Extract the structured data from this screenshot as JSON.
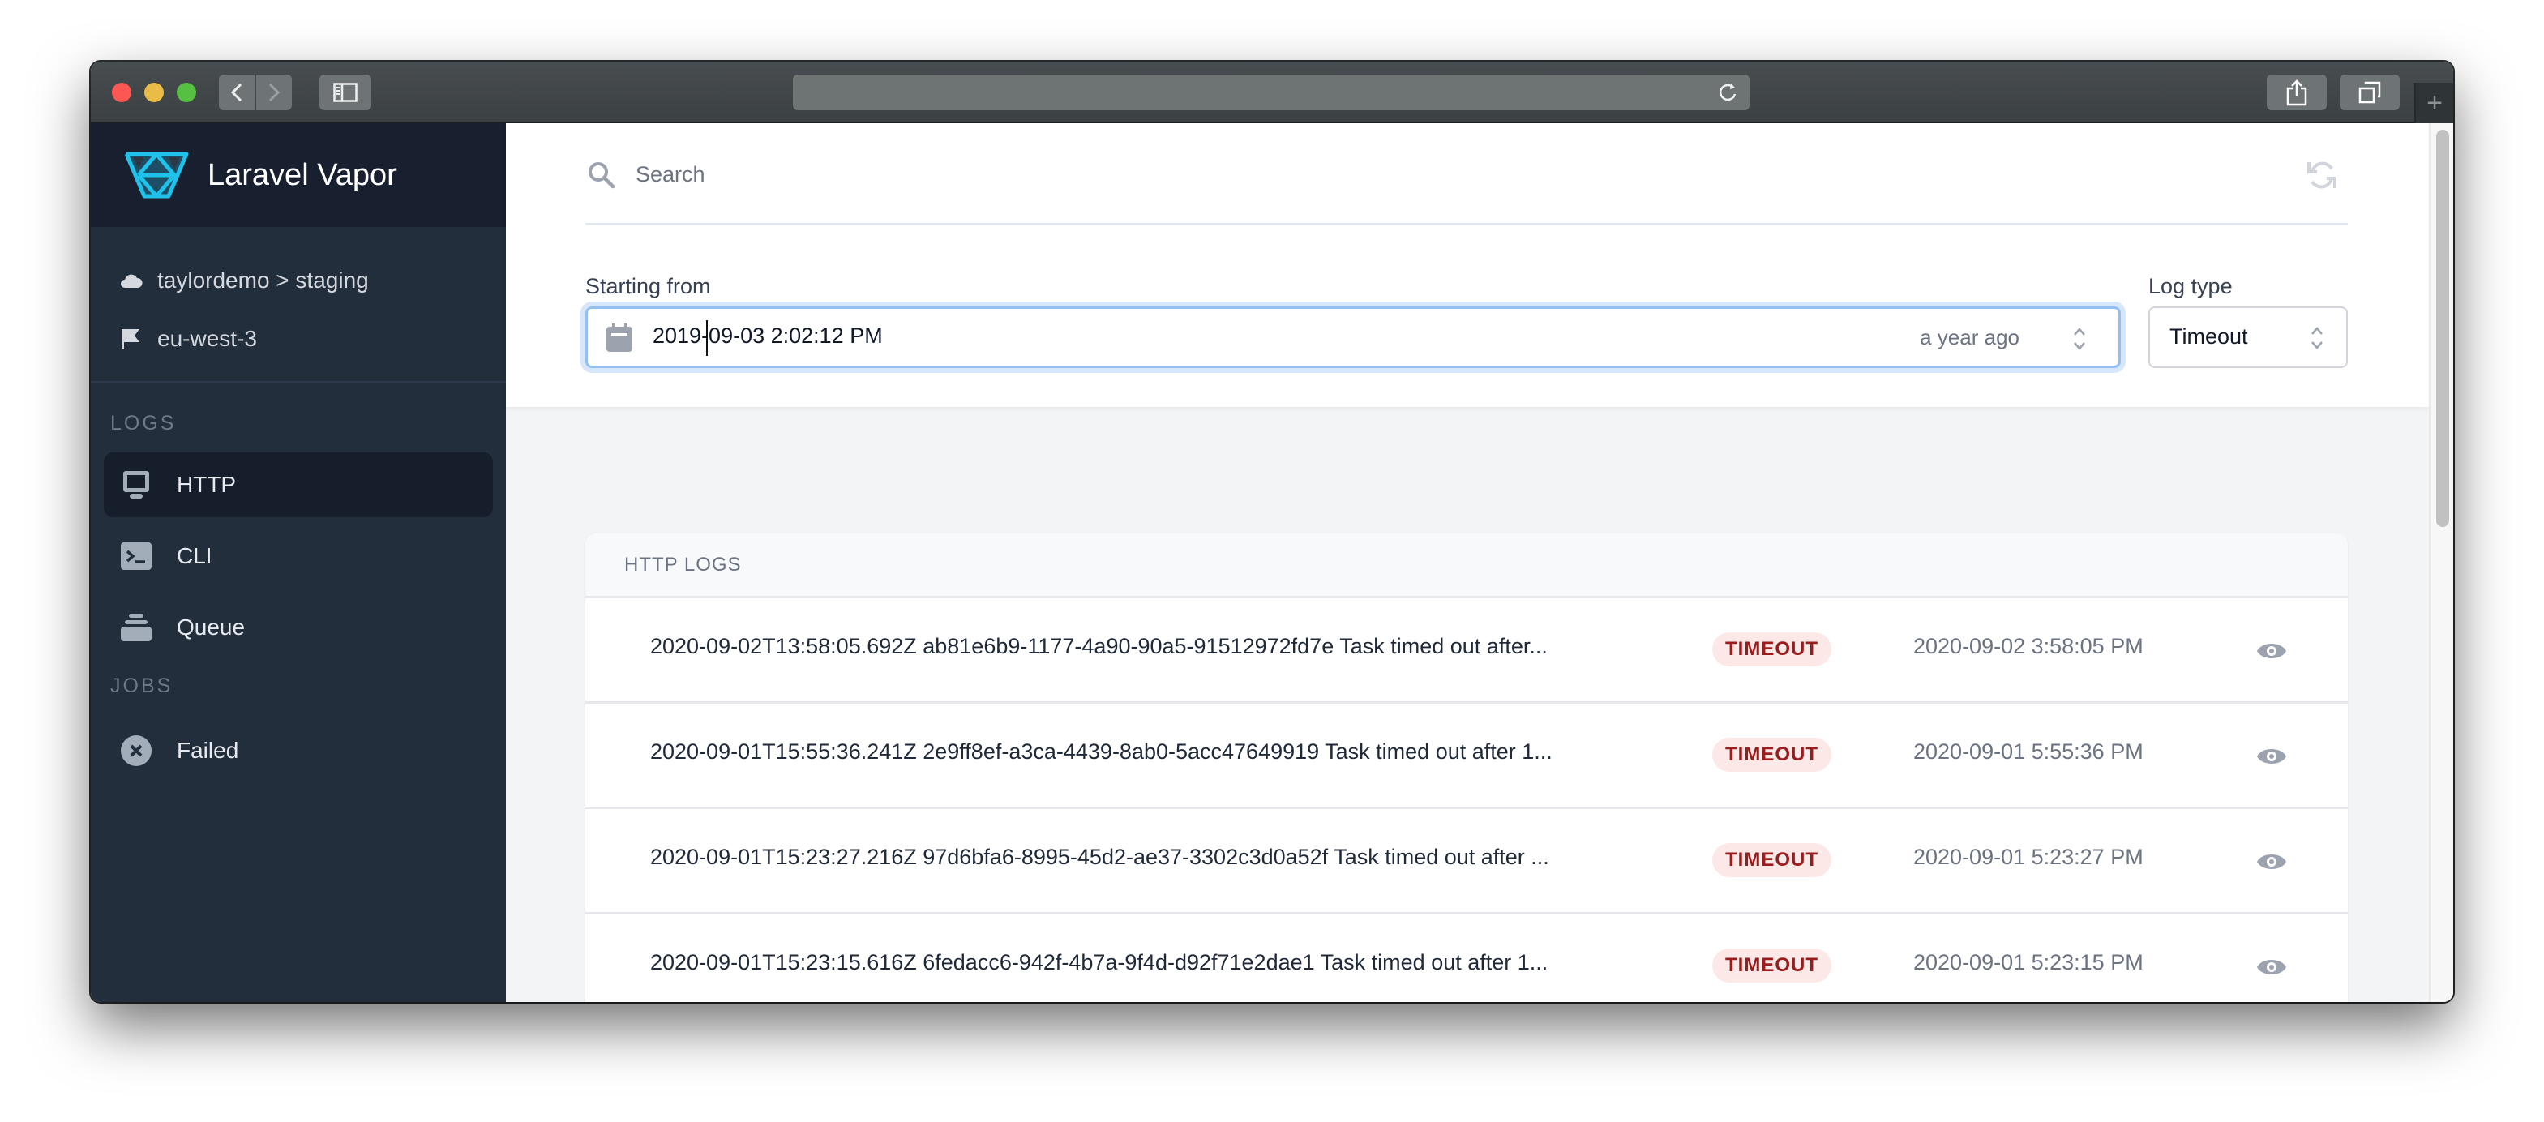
{
  "browser": {
    "nav_back": "back",
    "nav_forward": "forward",
    "icons": {
      "sidebar_toggle": "sidebar-icon",
      "reload": "reload-icon",
      "share": "share-icon",
      "tabs": "tabs-overview-icon",
      "new_tab": "+"
    }
  },
  "sidebar": {
    "brand": "Laravel Vapor",
    "environment": {
      "project_path": "taylordemo > staging",
      "region": "eu-west-3"
    },
    "sections": [
      {
        "label": "LOGS",
        "items": [
          {
            "label": "HTTP",
            "icon": "monitor-icon",
            "active": true
          },
          {
            "label": "CLI",
            "icon": "terminal-icon",
            "active": false
          },
          {
            "label": "Queue",
            "icon": "queue-icon",
            "active": false
          }
        ]
      },
      {
        "label": "JOBS",
        "items": [
          {
            "label": "Failed",
            "icon": "x-circle-icon",
            "active": false
          }
        ]
      }
    ]
  },
  "filters": {
    "search_placeholder": "Search",
    "search_value": "",
    "starting_from_label": "Starting from",
    "starting_from_value": "2019-09-03 2:02:12 PM",
    "starting_from_relative": "a year ago",
    "log_type_label": "Log type",
    "log_type_value": "Timeout"
  },
  "logs": {
    "title": "HTTP LOGS",
    "rows": [
      {
        "message": "2020-09-02T13:58:05.692Z ab81e6b9-1177-4a90-90a5-91512972fd7e Task timed out after...",
        "badge": "TIMEOUT",
        "time": "2020-09-02 3:58:05 PM"
      },
      {
        "message": "2020-09-01T15:55:36.241Z 2e9ff8ef-a3ca-4439-8ab0-5acc47649919 Task timed out after 1...",
        "badge": "TIMEOUT",
        "time": "2020-09-01 5:55:36 PM"
      },
      {
        "message": "2020-09-01T15:23:27.216Z 97d6bfa6-8995-45d2-ae37-3302c3d0a52f Task timed out after ...",
        "badge": "TIMEOUT",
        "time": "2020-09-01 5:23:27 PM"
      },
      {
        "message": "2020-09-01T15:23:15.616Z 6fedacc6-942f-4b7a-9f4d-d92f71e2dae1 Task timed out after 1...",
        "badge": "TIMEOUT",
        "time": "2020-09-01 5:23:15 PM"
      },
      {
        "message": "",
        "badge": "",
        "time": ""
      }
    ]
  },
  "colors": {
    "sidebar_bg": "#232e3d",
    "brand_bg": "#182030",
    "brand_accent": "#1ec2ea",
    "badge_bg": "#fde8e8",
    "badge_text": "#9b1c1c",
    "focus_ring": "#93c0f0"
  }
}
